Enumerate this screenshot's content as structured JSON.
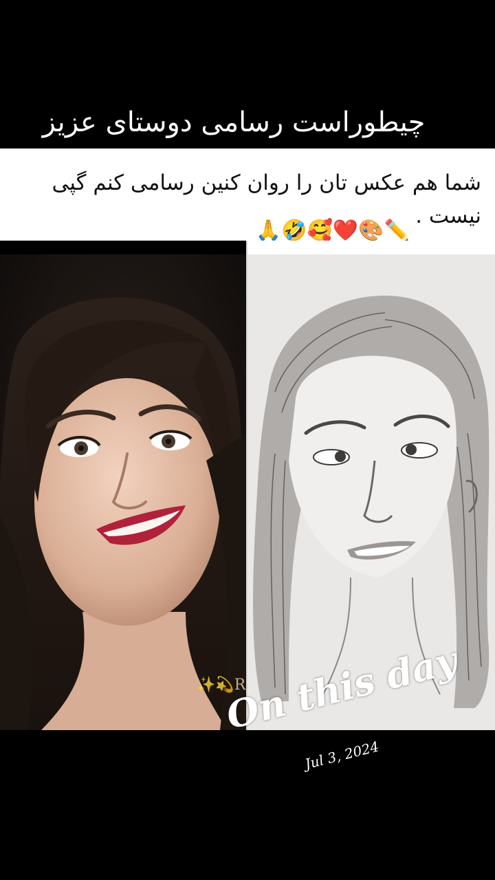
{
  "title": "چیطوراست رسامی دوستای عزیز",
  "caption": {
    "text": "شما هم عکس تان را روان کنین رسامی کنم گپی نیست .",
    "emojis": "🙏🤣🥰❤️🎨✏️"
  },
  "images": {
    "left": "smiling-woman-photo",
    "right": "pencil-sketch-portrait"
  },
  "watermark": "✨💫R",
  "overlay": {
    "heading": "On this day",
    "date": "Jul 3, 2024"
  },
  "colors": {
    "background": "#000000",
    "caption_bg": "#ffffff",
    "title_text": "#ffffff",
    "lip_color": "#b0223a"
  }
}
